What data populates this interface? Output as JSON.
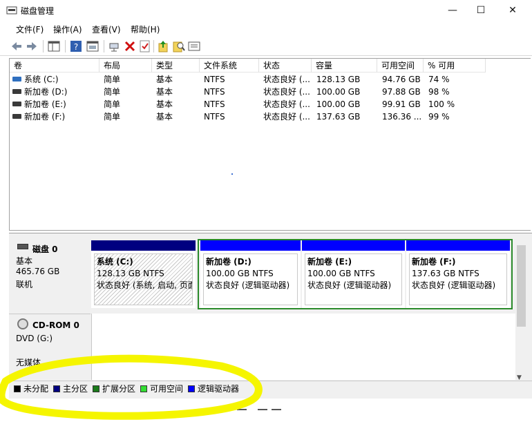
{
  "window": {
    "title": "磁盘管理",
    "minimize": "—",
    "maximize": "☐",
    "close": "✕"
  },
  "menu": [
    "文件(F)",
    "操作(A)",
    "查看(V)",
    "帮助(H)"
  ],
  "toolbar_icons": [
    "back-icon",
    "forward-icon",
    "console-tree-icon",
    "help-icon",
    "properties-icon",
    "connect-icon",
    "delete-icon",
    "check-icon",
    "up-icon",
    "search-icon",
    "list-icon"
  ],
  "volume_list": {
    "headers": [
      "卷",
      "布局",
      "类型",
      "文件系统",
      "状态",
      "容量",
      "可用空间",
      "% 可用"
    ],
    "rows": [
      {
        "vol": "系统 (C:)",
        "layout": "简单",
        "type": "基本",
        "fs": "NTFS",
        "status": "状态良好 (...",
        "capacity": "128.13 GB",
        "free": "94.76 GB",
        "pct": "74 %"
      },
      {
        "vol": "新加卷 (D:)",
        "layout": "简单",
        "type": "基本",
        "fs": "NTFS",
        "status": "状态良好 (...",
        "capacity": "100.00 GB",
        "free": "97.88 GB",
        "pct": "98 %"
      },
      {
        "vol": "新加卷 (E:)",
        "layout": "简单",
        "type": "基本",
        "fs": "NTFS",
        "status": "状态良好 (...",
        "capacity": "100.00 GB",
        "free": "99.91 GB",
        "pct": "100 %"
      },
      {
        "vol": "新加卷 (F:)",
        "layout": "简单",
        "type": "基本",
        "fs": "NTFS",
        "status": "状态良好 (...",
        "capacity": "137.63 GB",
        "free": "136.36 ...",
        "pct": "99 %"
      }
    ]
  },
  "disk0": {
    "name": "磁盘 0",
    "type": "基本",
    "size": "465.76 GB",
    "state": "联机",
    "partitions": [
      {
        "name": "系统  (C:)",
        "size": "128.13 GB NTFS",
        "status": "状态良好 (系统, 启动, 页面"
      },
      {
        "name": "新加卷  (D:)",
        "size": "100.00 GB NTFS",
        "status": "状态良好 (逻辑驱动器)"
      },
      {
        "name": "新加卷  (E:)",
        "size": "100.00 GB NTFS",
        "status": "状态良好 (逻辑驱动器)"
      },
      {
        "name": "新加卷  (F:)",
        "size": "137.63 GB NTFS",
        "status": "状态良好 (逻辑驱动器)"
      }
    ]
  },
  "cdrom": {
    "name": "CD-ROM 0",
    "drive": "DVD (G:)",
    "media": "无媒体"
  },
  "legend": [
    {
      "label": "未分配",
      "color": "#000000"
    },
    {
      "label": "主分区",
      "color": "#000080"
    },
    {
      "label": "扩展分区",
      "color": "#1a7a1a"
    },
    {
      "label": "可用空间",
      "color": "#33dd33"
    },
    {
      "label": "逻辑驱动器",
      "color": "#0000ff"
    }
  ],
  "colors": {
    "primary_band": "#000080",
    "logical_band": "#0000ff",
    "extended_border": "#2a8a2a",
    "highlight": "#f5f500"
  }
}
